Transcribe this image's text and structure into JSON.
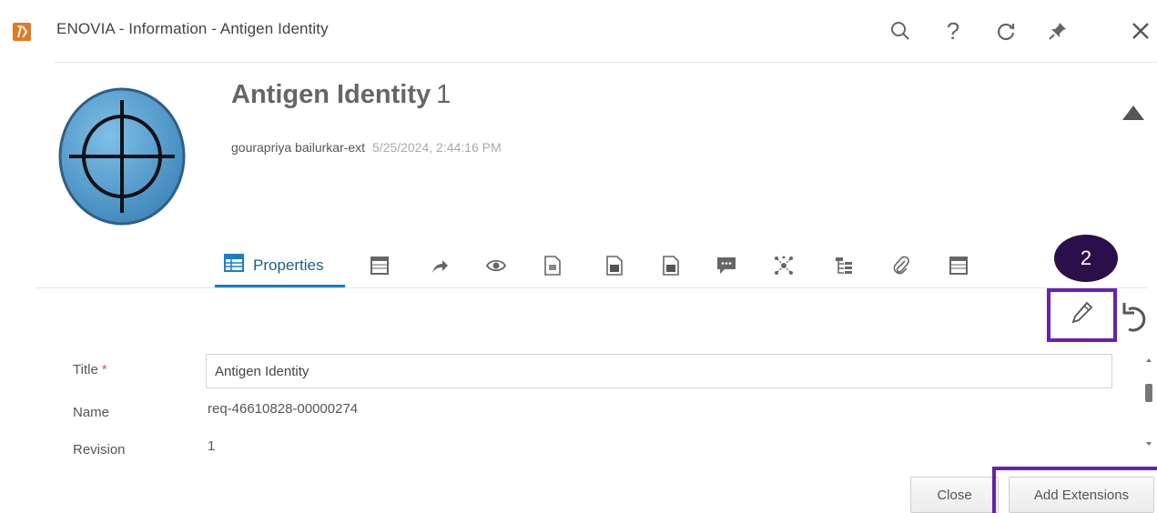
{
  "window": {
    "title": "ENOVIA - Information - Antigen Identity",
    "icons": [
      "search-icon",
      "help-icon",
      "refresh-icon",
      "pin-icon",
      "close-icon"
    ],
    "help_glyph": "?"
  },
  "header": {
    "object_name": "Antigen Identity",
    "revision": "1",
    "owner": "gourapriya bailurkar-ext",
    "modified": "5/25/2024, 2:44:16 PM",
    "avatar_icon": "crosshair-icon"
  },
  "tabs": {
    "active_label": "Properties",
    "icons": [
      "table-icon",
      "share-arrow-icon",
      "eye-icon",
      "document-icon",
      "document-filled-icon",
      "document-filled-icon",
      "comment-icon",
      "network-icon",
      "structure-icon",
      "paperclip-icon",
      "table-icon"
    ]
  },
  "callout": {
    "number": "2"
  },
  "form": {
    "title_label": "Title",
    "required_marker": "*",
    "title_value": "Antigen Identity",
    "name_label": "Name",
    "name_value": "req-46610828-00000274",
    "revision_label": "Revision",
    "revision_value": "1"
  },
  "footer": {
    "close_label": "Close",
    "add_extensions_label": "Add Extensions"
  },
  "colors": {
    "accent": "#1a7fc1",
    "highlight": "#6a1fb4",
    "callout_bg": "#2a0f4a",
    "brand_logo": "#e87722"
  }
}
